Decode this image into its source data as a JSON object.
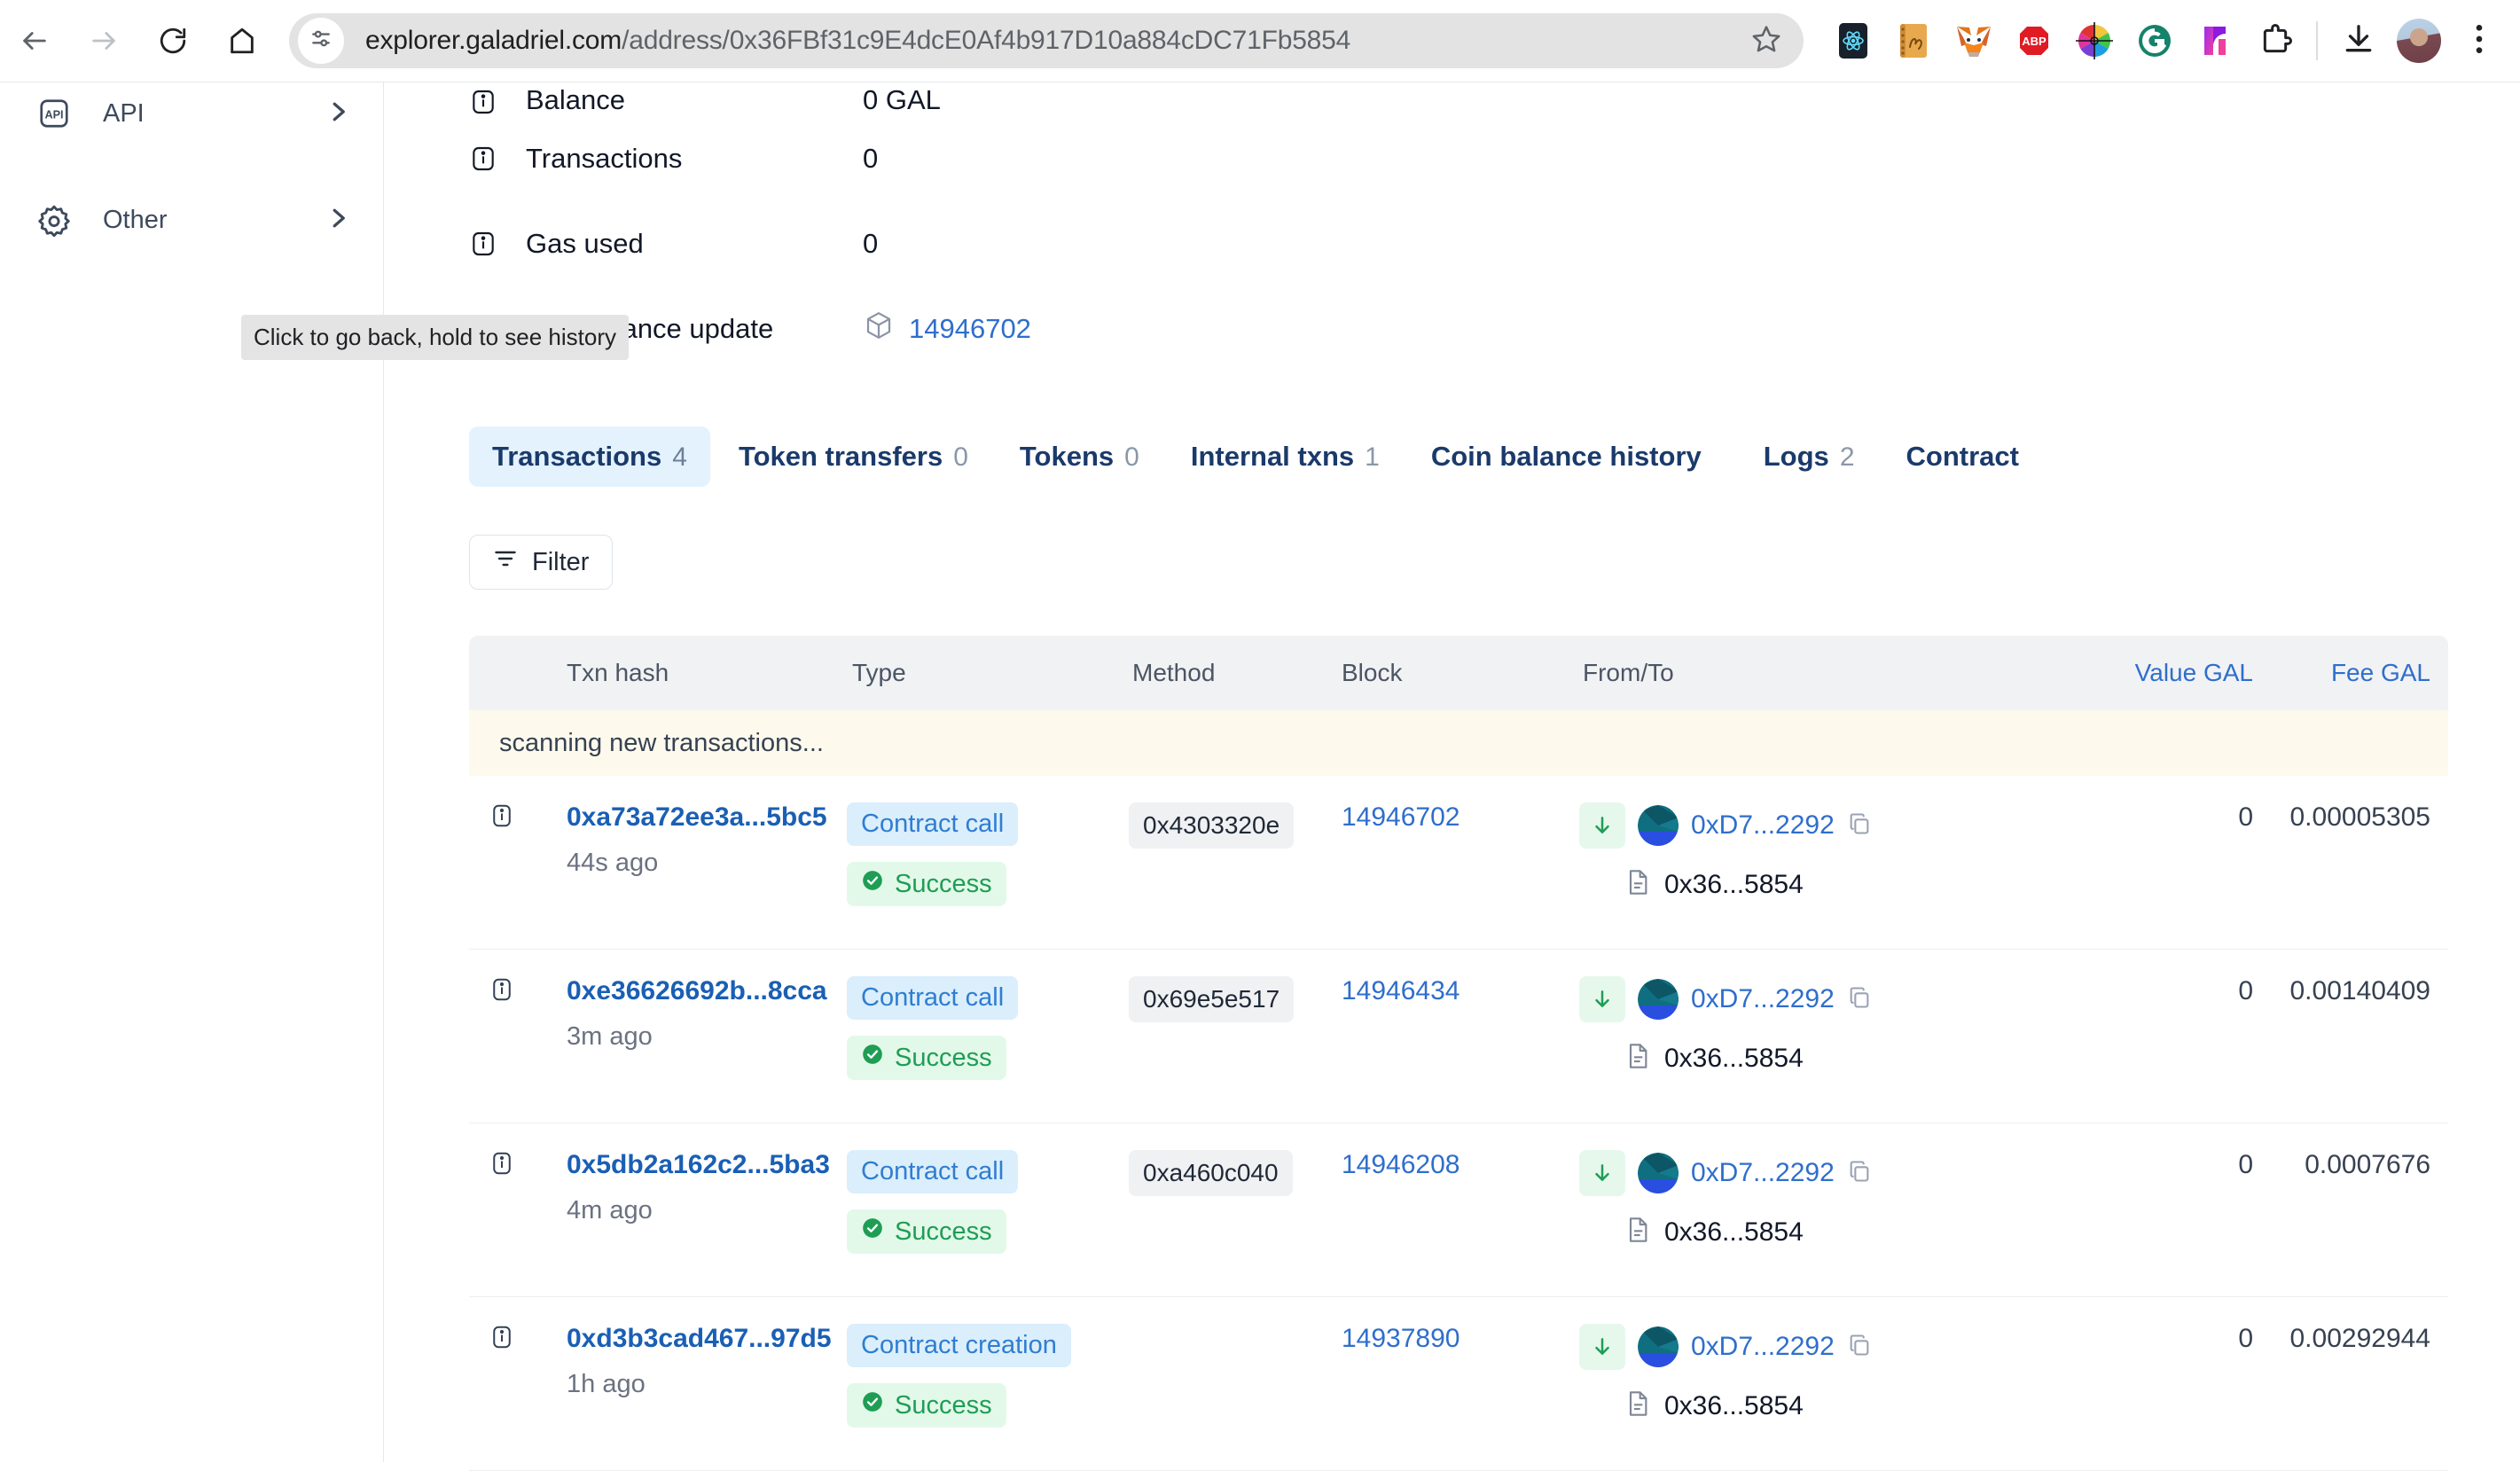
{
  "browser": {
    "back_icon": "arrow-left-icon",
    "forward_icon": "arrow-right-icon",
    "reload_icon": "reload-icon",
    "home_icon": "home-icon",
    "site_settings_icon": "tune-icon",
    "url_host": "explorer.galadriel.com",
    "url_path": "/address/0x36FBf31c9E4dcE0Af4b917D10a884cDC71Fb5854",
    "bookmark_icon": "star-icon",
    "extensions": [
      {
        "name": "react-devtools-extension-icon"
      },
      {
        "name": "perl-notebook-extension-icon"
      },
      {
        "name": "metamask-extension-icon"
      },
      {
        "name": "adblock-plus-extension-icon"
      },
      {
        "name": "color-picker-extension-icon"
      },
      {
        "name": "grammarly-extension-icon"
      },
      {
        "name": "notion-extension-icon"
      },
      {
        "name": "extensions-puzzle-icon"
      }
    ],
    "downloads_icon": "download-icon",
    "profile_icon": "profile-avatar",
    "menu_icon": "three-dot-menu-icon"
  },
  "tooltip": {
    "text": "Click to go back, hold to see history"
  },
  "sidebar": {
    "items": [
      {
        "label": "API",
        "icon": "api-icon",
        "chevron": "chevron-right-icon"
      },
      {
        "label": "Other",
        "icon": "gear-icon",
        "chevron": "chevron-right-icon"
      }
    ]
  },
  "details": {
    "rows": [
      {
        "label": "Balance",
        "value": "0 GAL",
        "icon": "info-icon",
        "link": false
      },
      {
        "label": "Transactions",
        "value": "0",
        "icon": "info-icon",
        "link": false
      },
      {
        "label": "Gas used",
        "value": "0",
        "icon": "info-icon",
        "link": false
      },
      {
        "label": "Last balance update",
        "value": "14946702",
        "icon": "info-icon",
        "link": true,
        "block_icon": "cube-icon"
      }
    ]
  },
  "tabs": [
    {
      "label": "Transactions",
      "count": "4",
      "active": true
    },
    {
      "label": "Token transfers",
      "count": "0",
      "active": false
    },
    {
      "label": "Tokens",
      "count": "0",
      "active": false
    },
    {
      "label": "Internal txns",
      "count": "1",
      "active": false
    },
    {
      "label": "Coin balance history",
      "count": "",
      "active": false
    },
    {
      "label": "Logs",
      "count": "2",
      "active": false
    },
    {
      "label": "Contract",
      "count": "",
      "active": false
    }
  ],
  "filter": {
    "label": "Filter",
    "icon": "filter-icon"
  },
  "table": {
    "headers": {
      "info": "",
      "txn_hash": "Txn hash",
      "type": "Type",
      "method": "Method",
      "block": "Block",
      "from_to": "From/To",
      "value": "Value GAL",
      "fee": "Fee GAL"
    },
    "banner": "scanning new transactions...",
    "rows": [
      {
        "info_icon": "info-icon",
        "hash": "0xa73a72ee3a...5bc5",
        "age": "44s ago",
        "type": "Contract call",
        "status": "Success",
        "status_icon": "check-circle-icon",
        "method": "0x4303320e",
        "block": "14946702",
        "direction_icon": "arrow-down-icon",
        "from_addr": "0xD7...2292",
        "copy_icon": "copy-icon",
        "to_icon": "document-icon",
        "to_addr": "0x36...5854",
        "value": "0",
        "fee": "0.00005305"
      },
      {
        "info_icon": "info-icon",
        "hash": "0xe36626692b...8cca",
        "age": "3m ago",
        "type": "Contract call",
        "status": "Success",
        "status_icon": "check-circle-icon",
        "method": "0x69e5e517",
        "block": "14946434",
        "direction_icon": "arrow-down-icon",
        "from_addr": "0xD7...2292",
        "copy_icon": "copy-icon",
        "to_icon": "document-icon",
        "to_addr": "0x36...5854",
        "value": "0",
        "fee": "0.00140409"
      },
      {
        "info_icon": "info-icon",
        "hash": "0x5db2a162c2...5ba3",
        "age": "4m ago",
        "type": "Contract call",
        "status": "Success",
        "status_icon": "check-circle-icon",
        "method": "0xa460c040",
        "block": "14946208",
        "direction_icon": "arrow-down-icon",
        "from_addr": "0xD7...2292",
        "copy_icon": "copy-icon",
        "to_icon": "document-icon",
        "to_addr": "0x36...5854",
        "value": "0",
        "fee": "0.0007676"
      },
      {
        "info_icon": "info-icon",
        "hash": "0xd3b3cad467...97d5",
        "age": "1h ago",
        "type": "Contract creation",
        "status": "Success",
        "status_icon": "check-circle-icon",
        "method": "",
        "block": "14937890",
        "direction_icon": "arrow-down-icon",
        "from_addr": "0xD7...2292",
        "copy_icon": "copy-icon",
        "to_icon": "document-icon",
        "to_addr": "0x36...5854",
        "value": "0",
        "fee": "0.00292944"
      }
    ]
  },
  "colors": {
    "link": "#2f6ecc",
    "hash_link": "#1a5fb4",
    "success": "#1f9d55",
    "tab_active_bg": "#e4f2fd",
    "banner_bg": "#fdfaed",
    "type_badge_bg": "#daeefc"
  }
}
